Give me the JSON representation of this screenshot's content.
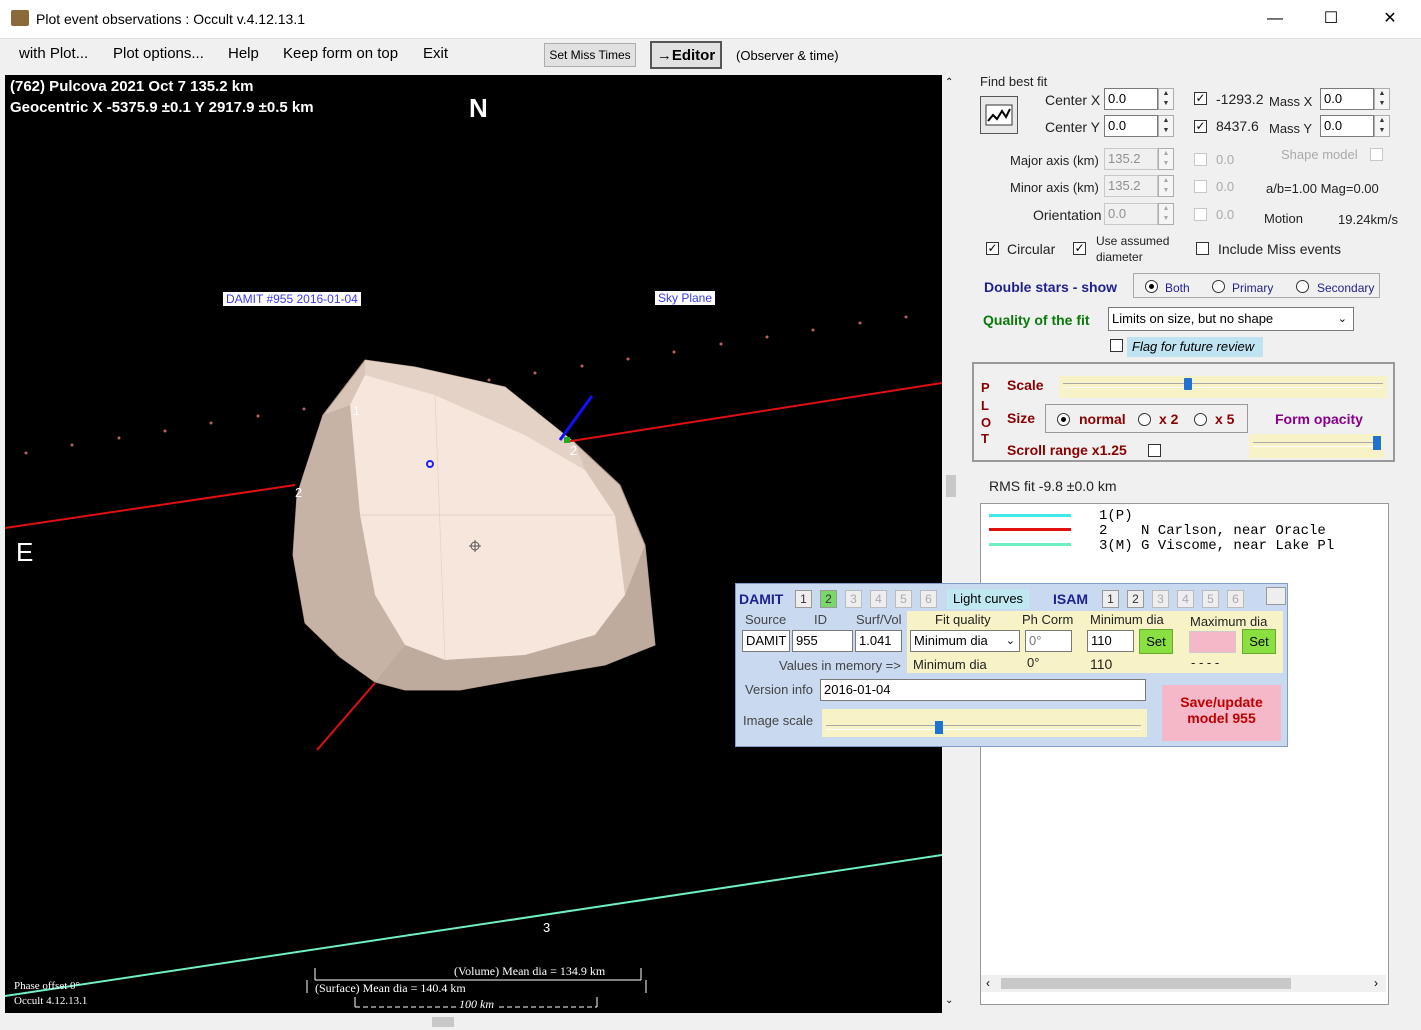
{
  "window": {
    "title": "Plot event observations : Occult v.4.12.13.1",
    "min": "—",
    "max": "☐",
    "close": "✕"
  },
  "menu": {
    "with_plot": "with Plot...",
    "plot_options": "Plot options...",
    "help": "Help",
    "keep_on_top": "Keep form on top",
    "exit": "Exit",
    "set_miss_times": "Set Miss Times",
    "editor": "→Editor",
    "observer_time": "(Observer & time)"
  },
  "plot": {
    "header_line1": "(762) Pulcova  2021 Oct 7   135.2 km",
    "header_line2": "Geocentric  X  -5375.9 ±0.1  Y 2917.9 ±0.5 km",
    "north": "N",
    "east": "E",
    "damit_label": "DAMIT #955 2016-01-04",
    "sky_plane": "Sky Plane",
    "chord_labels": [
      "1",
      "2",
      "2",
      "3"
    ],
    "volume_dia": "(Volume) Mean dia = 134.9 km",
    "surface_dia": "(Surface) Mean dia = 140.4 km",
    "scale_bar": "100 km",
    "phase_offset": "Phase offset 0°",
    "version": "Occult 4.12.13.1"
  },
  "fit": {
    "find_best_fit": "Find best fit",
    "center_x_label": "Center X",
    "center_x": "0.0",
    "center_y_label": "Center Y",
    "center_y": "0.0",
    "x_value": "-1293.2",
    "y_value": "8437.6",
    "mass_x_label": "Mass X",
    "mass_x": "0.0",
    "mass_y_label": "Mass Y",
    "mass_y": "0.0",
    "major_label": "Major axis (km)",
    "major": "135.2",
    "major_chk": "0.0",
    "minor_label": "Minor axis (km)",
    "minor": "135.2",
    "minor_chk": "0.0",
    "orient_label": "Orientation",
    "orient": "0.0",
    "orient_chk": "0.0",
    "shape_model": "Shape model",
    "ab_mag": "a/b=1.00  Mag=0.00",
    "motion_label": "Motion",
    "motion": "19.24km/s",
    "circular": "Circular",
    "use_assumed_1": "Use assumed",
    "use_assumed_2": "diameter",
    "include_miss": "Include Miss events",
    "double_stars": "Double stars - show",
    "both": "Both",
    "primary": "Primary",
    "secondary": "Secondary",
    "quality_label": "Quality of the fit",
    "quality_value": "Limits on size, but no shape",
    "flag_review": "Flag for future review"
  },
  "plotbox": {
    "side": [
      "P",
      "L",
      "O",
      "T"
    ],
    "scale": "Scale",
    "size": "Size",
    "normal": "normal",
    "x2": "x 2",
    "x5": "x 5",
    "form_opacity": "Form opacity",
    "scroll_range": "Scroll range x1.25"
  },
  "rms": "RMS fit -9.8 ±0.0 km",
  "legend": [
    {
      "color": "#40e8e8",
      "text": "1(P)"
    },
    {
      "color": "#e01010",
      "text": "2    N Carlson, near Oracle"
    },
    {
      "color": "#70f0c0",
      "text": "3(M) G Viscome, near Lake Pl"
    }
  ],
  "damit": {
    "damit": "DAMIT",
    "damit_nums": [
      "1",
      "2",
      "3",
      "4",
      "5",
      "6"
    ],
    "light_curves": "Light curves",
    "isam": "ISAM",
    "isam_nums": [
      "1",
      "2",
      "3",
      "4",
      "5",
      "6"
    ],
    "source_label": "Source",
    "id_label": "ID",
    "surfvol_label": "Surf/Vol",
    "source": "DAMIT",
    "id": "955",
    "surfvol": "1.041",
    "fit_quality_label": "Fit quality",
    "ph_corr_label": "Ph Corm",
    "min_dia_label": "Minimum dia",
    "max_dia_label": "Maximum dia",
    "fit_quality": "Minimum dia",
    "ph_corr": "0°",
    "min_dia": "110",
    "set": "Set",
    "values_in_memory": "Values in memory =>",
    "mem_fit": "Minimum dia",
    "mem_ph": "0°",
    "mem_min": "110",
    "mem_max": "- - - -",
    "version_label": "Version info",
    "version": "2016-01-04",
    "image_scale": "Image scale",
    "save_1": "Save/update",
    "save_2": "model 955"
  }
}
